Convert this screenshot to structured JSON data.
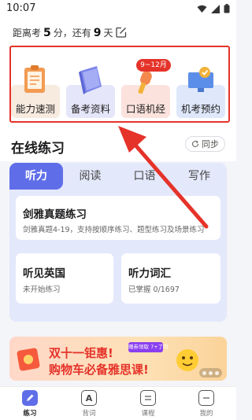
{
  "status_bar": {
    "time": "10:07"
  },
  "countdown": {
    "prefix": "距离考",
    "minutes": "5",
    "mid": "分，还有",
    "days": "9",
    "suffix": "天"
  },
  "quick_actions": {
    "items": [
      {
        "label": "能力速测",
        "icon": "clipboard-icon",
        "bg": "#f7eadf"
      },
      {
        "label": "备考资料",
        "icon": "book-icon",
        "bg": "#e6e6fb"
      },
      {
        "label": "口语机经",
        "icon": "microphone-icon",
        "bg": "#fbe2dc"
      },
      {
        "label": "机考预约",
        "icon": "monitor-check-icon",
        "bg": "#dfe8fb"
      }
    ],
    "badge": "9~12月"
  },
  "online_practice": {
    "title": "在线练习",
    "sync_label": "同步"
  },
  "tabs": [
    {
      "label": "听力",
      "active": true
    },
    {
      "label": "阅读",
      "active": false
    },
    {
      "label": "口语",
      "active": false
    },
    {
      "label": "写作",
      "active": false
    }
  ],
  "cards": {
    "cambridge": {
      "title": "剑雅真题练习",
      "subtitle": "剑雅真题4-19，支持按顺序练习、题型练习及场景练习"
    },
    "listen_uk": {
      "title": "听见英国",
      "subtitle": "未开始练习"
    },
    "vocab": {
      "title": "听力词汇",
      "subtitle": "已掌握 0/1697"
    }
  },
  "banner": {
    "line1": "双十一钜惠!",
    "line2": "购物车必备雅思课!",
    "tag": "赠券领取 7+了吗"
  },
  "bottom_nav": [
    {
      "label": "练习",
      "icon": "pencil-icon",
      "active": true
    },
    {
      "label": "背词",
      "icon": "letter-a-icon",
      "active": false
    },
    {
      "label": "课程",
      "icon": "course-icon",
      "active": false
    },
    {
      "label": "我的",
      "icon": "profile-icon",
      "active": false
    }
  ],
  "colors": {
    "accent": "#5f6ee8",
    "highlight": "#e5332a",
    "tab_bg": "#e4e8fb"
  }
}
